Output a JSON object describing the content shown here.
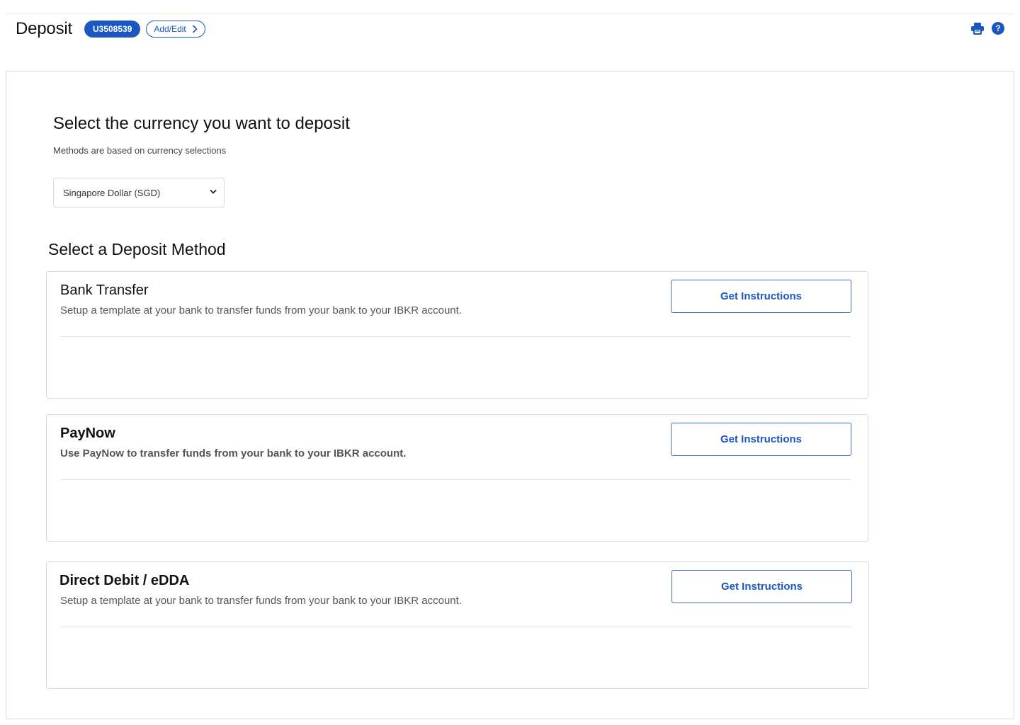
{
  "header": {
    "title": "Deposit",
    "account_id": "U3508539",
    "add_edit_label": "Add/Edit",
    "icons": [
      "printer-icon",
      "help-icon"
    ],
    "help_glyph": "?"
  },
  "currency": {
    "heading": "Select the currency you want to deposit",
    "subtext": "Methods are based on currency selections",
    "selected": "Singapore Dollar (SGD)"
  },
  "methods": {
    "heading": "Select a Deposit Method",
    "items": [
      {
        "title": "Bank Transfer",
        "description": "Setup a template at your bank to transfer funds from your bank to your IBKR account.",
        "button_label": "Get Instructions"
      },
      {
        "title": "PayNow",
        "description": "Use PayNow to transfer funds from your bank to your IBKR account.",
        "button_label": "Get Instructions"
      },
      {
        "title": "Direct Debit / eDDA",
        "description": "Setup a template at your bank to transfer funds from your bank to your IBKR account.",
        "button_label": "Get Instructions"
      }
    ]
  },
  "colors": {
    "accent": "#1a57c2",
    "border": "#d9d9d9"
  }
}
